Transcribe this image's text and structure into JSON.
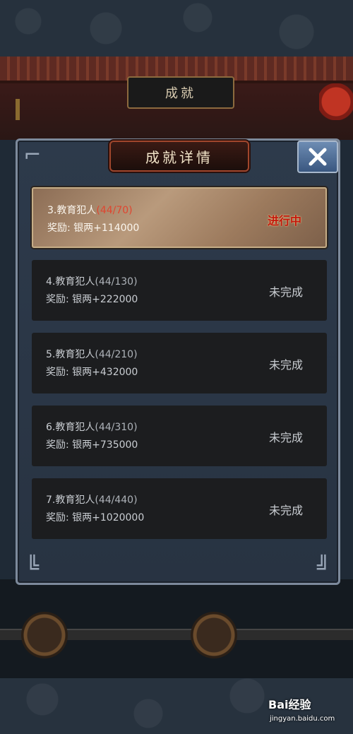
{
  "background": {
    "panel_title": "成就"
  },
  "dialog": {
    "title": "成就详情",
    "close_icon": "close-x-icon"
  },
  "achievements": [
    {
      "name": "3.教育犯人",
      "progress": "(44/70)",
      "reward": "奖励:  银两+114000",
      "status": "进行中",
      "active": true
    },
    {
      "name": "4.教育犯人",
      "progress": "(44/130)",
      "reward": "奖励:  银两+222000",
      "status": "未完成",
      "active": false
    },
    {
      "name": "5.教育犯人",
      "progress": "(44/210)",
      "reward": "奖励:  银两+432000",
      "status": "未完成",
      "active": false
    },
    {
      "name": "6.教育犯人",
      "progress": "(44/310)",
      "reward": "奖励:  银两+735000",
      "status": "未完成",
      "active": false
    },
    {
      "name": "7.教育犯人",
      "progress": "(44/440)",
      "reward": "奖励:  银两+1020000",
      "status": "未完成",
      "active": false
    }
  ],
  "watermark": {
    "brand": "Bai经验",
    "url": "jingyan.baidu.com"
  }
}
